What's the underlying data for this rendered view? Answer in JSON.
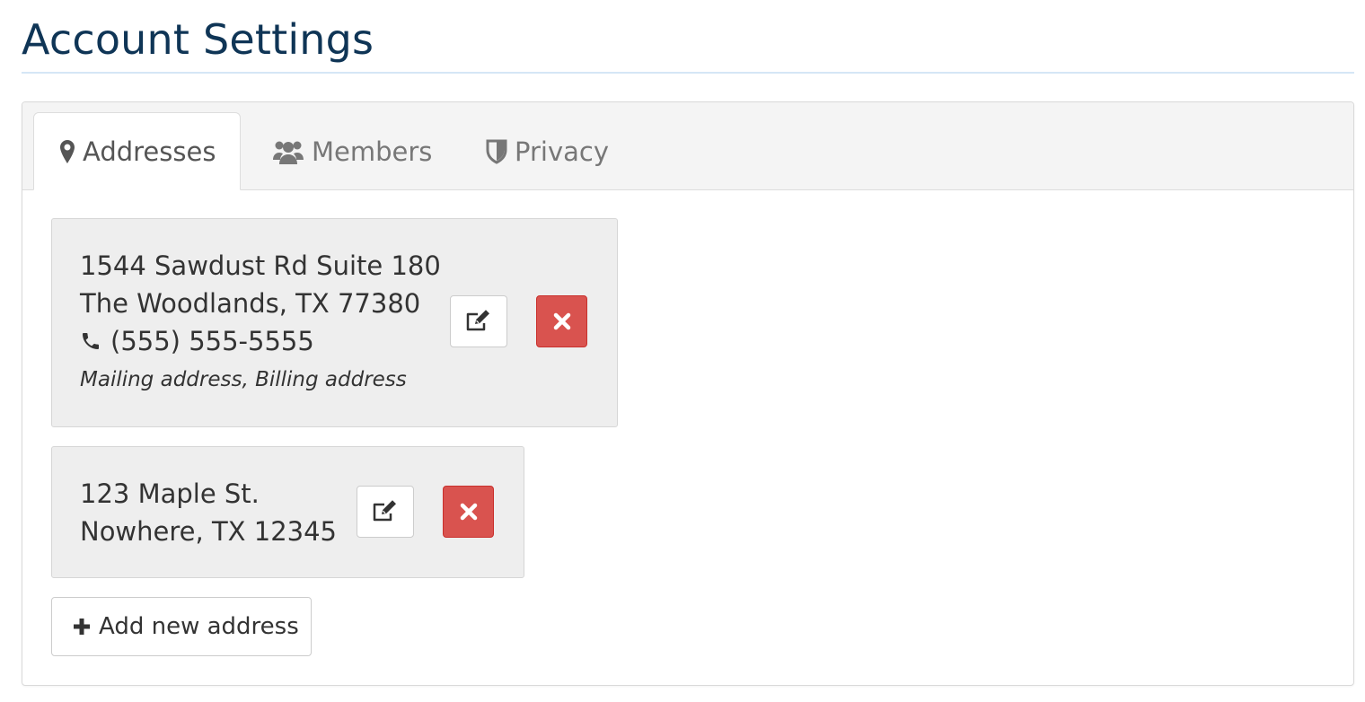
{
  "page": {
    "title": "Account Settings"
  },
  "tabs": [
    {
      "label": "Addresses",
      "icon": "map-marker-icon",
      "active": true
    },
    {
      "label": "Members",
      "icon": "users-icon",
      "active": false
    },
    {
      "label": "Privacy",
      "icon": "shield-icon",
      "active": false
    }
  ],
  "addresses": [
    {
      "line1": "1544 Sawdust Rd Suite 180",
      "line2": "The Woodlands, TX 77380",
      "phone": "(555) 555-5555",
      "tags": "Mailing address, Billing address"
    },
    {
      "line1": "123 Maple St.",
      "line2": "Nowhere, TX 12345"
    }
  ],
  "actions": {
    "add_address_label": "Add new address"
  },
  "colors": {
    "title": "#0f3556",
    "danger": "#d9534f",
    "card_bg": "#eeeeee",
    "tabbar_bg": "#f4f4f4"
  }
}
